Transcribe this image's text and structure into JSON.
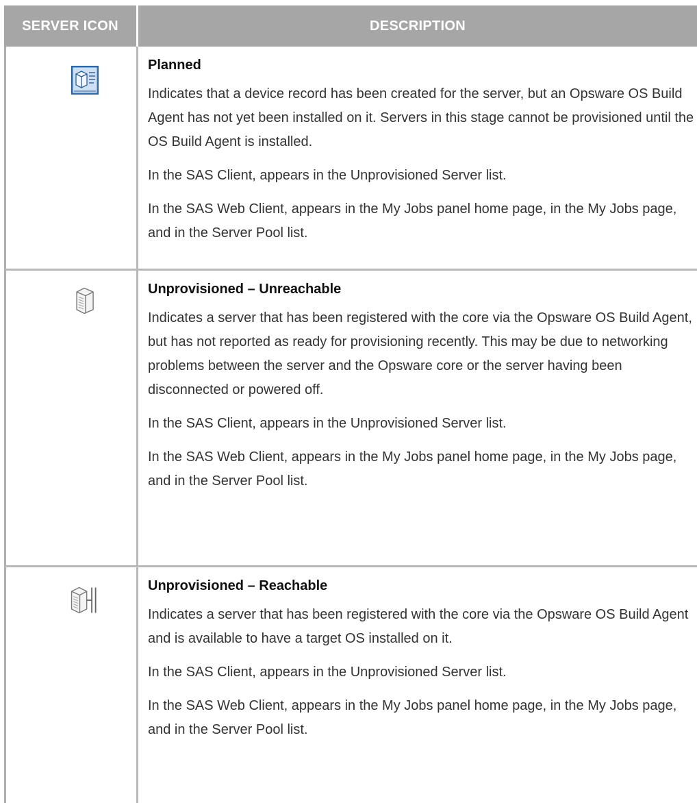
{
  "header": {
    "col_icon": "SERVER ICON",
    "col_desc": "DESCRIPTION"
  },
  "rows": [
    {
      "icon": "planned-server-icon",
      "title": "Planned",
      "paragraphs": [
        "Indicates that a device record has been created for the server, but an Opsware OS Build Agent has not yet been installed on it. Servers in this stage cannot be provisioned until the OS Build Agent is installed.",
        "In the SAS Client, appears in the Unprovisioned Server list.",
        "In the SAS Web Client, appears in the My Jobs panel home page, in the My Jobs page, and in the Server Pool list."
      ]
    },
    {
      "icon": "unreachable-server-icon",
      "title": "Unprovisioned – Unreachable",
      "paragraphs": [
        "Indicates a server that has been registered with the core via the Opsware OS Build Agent, but has not reported as ready for provisioning recently. This may be due to networking problems between the server and the Opsware core or the server having been disconnected or powered off.",
        "In the SAS Client, appears in the Unprovisioned Server list.",
        "In the SAS Web Client, appears in the My Jobs panel home page, in the My Jobs page, and in the Server Pool list."
      ]
    },
    {
      "icon": "reachable-server-icon",
      "title": "Unprovisioned – Reachable",
      "paragraphs": [
        "Indicates a server that has been registered with the core via the Opsware OS Build Agent and is available to have a target OS installed on it.",
        "In the SAS Client, appears in the Unprovisioned Server list.",
        "In the SAS Web Client, appears in the My Jobs panel home page, in the My Jobs page, and in the Server Pool list."
      ]
    }
  ]
}
